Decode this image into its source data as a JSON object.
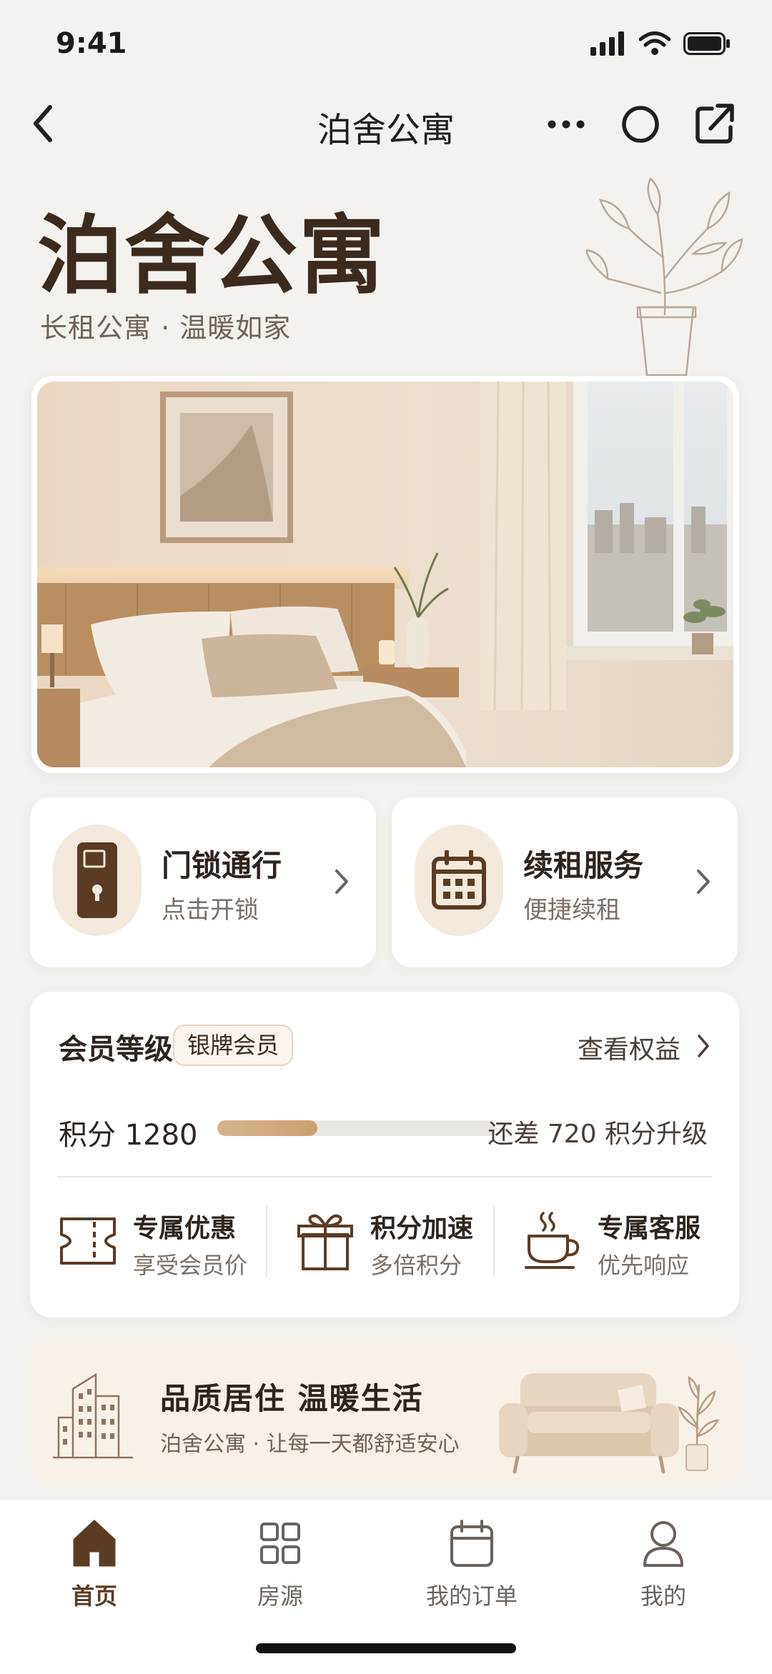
{
  "status_bar": {
    "time": "9:41"
  },
  "nav": {
    "title": "泊舍公寓",
    "icons": [
      "back-icon",
      "more-icon",
      "record-icon",
      "share-icon"
    ]
  },
  "hero": {
    "title": "泊舍公寓",
    "subtitle": "长租公寓 · 温暖如家"
  },
  "quick_actions": [
    {
      "title": "门锁通行",
      "subtitle": "点击开锁",
      "icon": "door-lock-icon"
    },
    {
      "title": "续租服务",
      "subtitle": "便捷续租",
      "icon": "calendar-icon"
    }
  ],
  "member": {
    "title": "会员等级",
    "badge": "银牌会员",
    "link": "查看权益",
    "points_label": "积分 1280",
    "points_progress": 0.36,
    "points_need": "还差 720 积分升级",
    "benefits": [
      {
        "title": "专属优惠",
        "subtitle": "享受会员价",
        "icon": "coupon-icon"
      },
      {
        "title": "积分加速",
        "subtitle": "多倍积分",
        "icon": "gift-icon"
      },
      {
        "title": "专属客服",
        "subtitle": "优先响应",
        "icon": "coffee-cup-icon"
      }
    ]
  },
  "banner": {
    "title": "品质居住  温暖生活",
    "subtitle": "泊舍公寓 · 让每一天都舒适安心"
  },
  "tabs": [
    {
      "label": "首页",
      "icon": "home-icon",
      "active": true
    },
    {
      "label": "房源",
      "icon": "grid-icon",
      "active": false
    },
    {
      "label": "我的订单",
      "icon": "order-calendar-icon",
      "active": false
    },
    {
      "label": "我的",
      "icon": "person-icon",
      "active": false
    }
  ],
  "colors": {
    "background": "#f4f2ef",
    "accent_brown": "#5a3c25",
    "progress": "#d5b48b",
    "icon_bg": "#f3e9dc"
  }
}
